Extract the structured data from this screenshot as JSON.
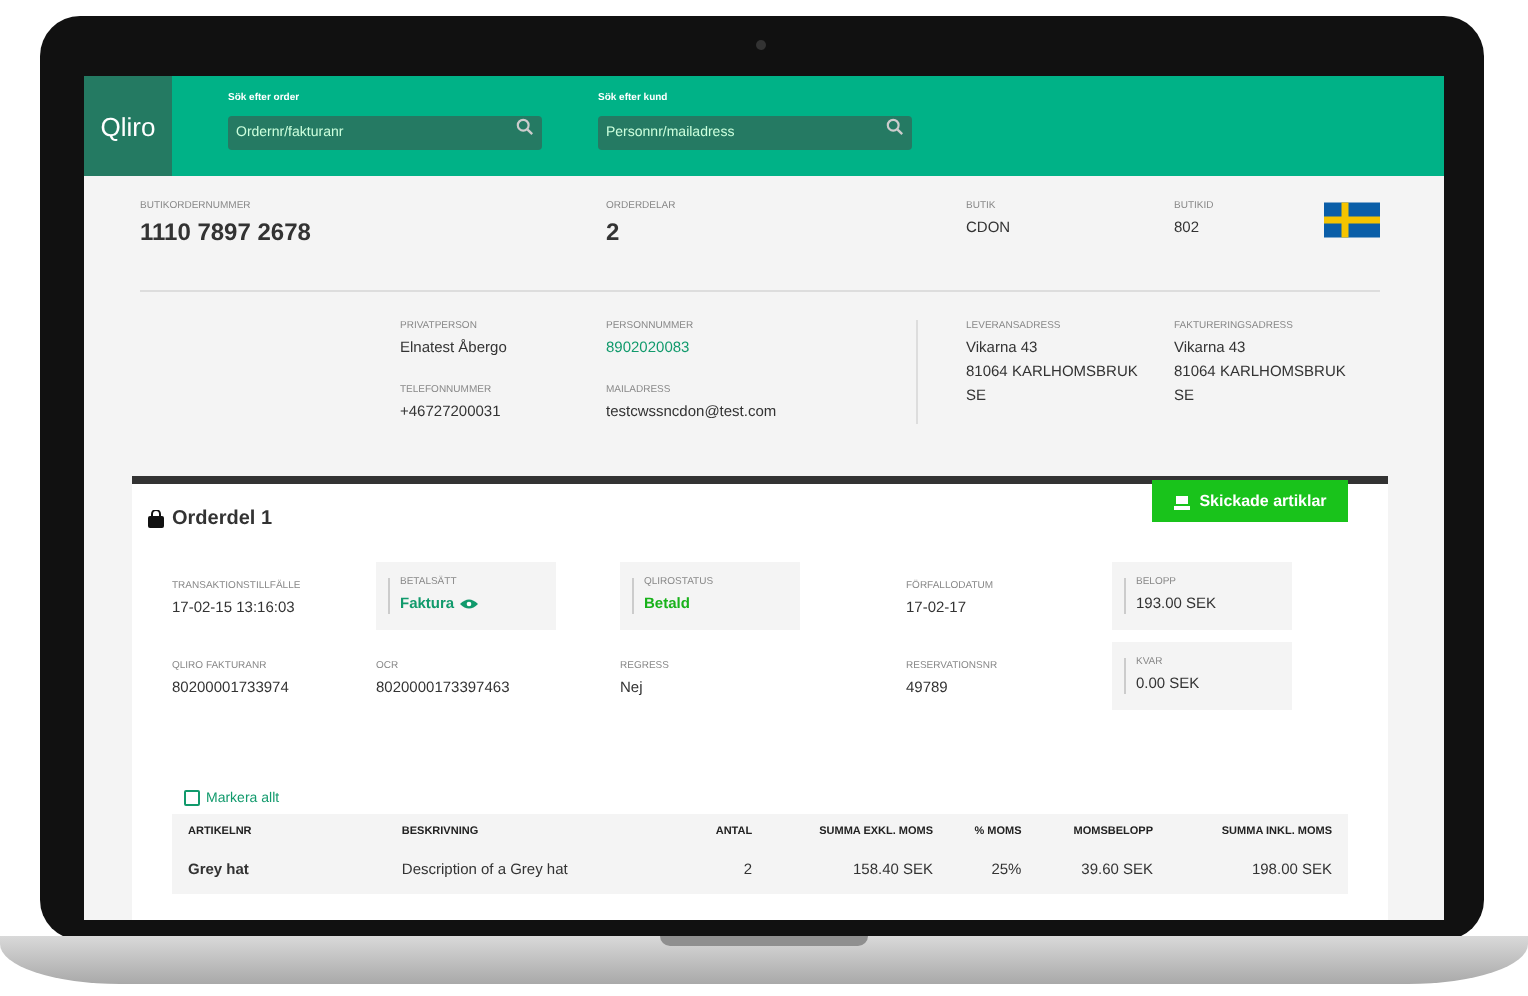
{
  "header": {
    "logo": "Qliro",
    "searches": [
      {
        "label": "Sök efter order",
        "placeholder": "Ordernr/fakturanr"
      },
      {
        "label": "Sök efter kund",
        "placeholder": "Personnr/mailadress"
      }
    ]
  },
  "summary": [
    {
      "label": "BUTIKORDERNUMMER",
      "value": "1110 7897 2678",
      "large": true
    },
    {
      "label": "ORDERDELAR",
      "value": "2",
      "large": true
    },
    {
      "label": "BUTIK",
      "value": "CDON",
      "large": false
    },
    {
      "label": "BUTIKID",
      "value": "802",
      "large": false
    }
  ],
  "customer": {
    "contact": [
      {
        "label": "PRIVATPERSON",
        "value": "Elnatest Åbergo",
        "link": false
      },
      {
        "label": "PERSONNUMMER",
        "value": "8902020083",
        "link": true
      },
      {
        "label": "TELEFONNUMMER",
        "value": "+46727200031",
        "link": false
      },
      {
        "label": "MAILADRESS",
        "value": "testcwssncdon@test.com",
        "link": false
      }
    ],
    "addresses": [
      {
        "label": "LEVERANSADRESS",
        "lines": [
          "Vikarna 43",
          "81064 KARLHOMSBRUK",
          "SE"
        ]
      },
      {
        "label": "FAKTURERINGSADRESS",
        "lines": [
          "Vikarna 43",
          "81064 KARLHOMSBRUK",
          "SE"
        ]
      }
    ]
  },
  "order_part": {
    "title": "Orderdel 1",
    "button": "Skickade artiklar",
    "fields": [
      {
        "label": "TRANSAKTIONSTILLFÄLLE",
        "value": "17-02-15 13:16:03",
        "boxed": false,
        "kind": "plain"
      },
      {
        "label": "BETALSÄTT",
        "value": "Faktura",
        "boxed": true,
        "kind": "link",
        "viewable": true
      },
      {
        "label": "QLIROSTATUS",
        "value": "Betald",
        "boxed": true,
        "kind": "success"
      },
      {
        "label": "FÖRFALLODATUM",
        "value": "17-02-17",
        "boxed": false,
        "kind": "plain"
      },
      {
        "label": "BELOPP",
        "value": "193.00 SEK",
        "boxed": true,
        "kind": "plain"
      },
      {
        "label": "QLIRO FAKTURANR",
        "value": "80200001733974",
        "boxed": false,
        "kind": "plain"
      },
      {
        "label": "OCR",
        "value": "8020000173397463",
        "boxed": false,
        "kind": "plain"
      },
      {
        "label": "REGRESS",
        "value": "Nej",
        "boxed": false,
        "kind": "plain"
      },
      {
        "label": "RESERVATIONSNR",
        "value": "49789",
        "boxed": false,
        "kind": "plain"
      },
      {
        "label": "KVAR",
        "value": "0.00 SEK",
        "boxed": true,
        "kind": "plain"
      }
    ],
    "select_all": {
      "label": "Markera allt",
      "checked": false
    },
    "table": {
      "columns": [
        {
          "label": "ARTIKELNR",
          "kind": "text"
        },
        {
          "label": "BESKRIVNING",
          "kind": "text"
        },
        {
          "label": "ANTAL",
          "kind": "number"
        },
        {
          "label": "SUMMA EXKL. MOMS",
          "kind": "number"
        },
        {
          "label": "% MOMS",
          "kind": "number"
        },
        {
          "label": "MOMSBELOPP",
          "kind": "number"
        },
        {
          "label": "SUMMA INKL. MOMS",
          "kind": "number"
        }
      ],
      "rows": [
        [
          "Grey hat",
          "Description of a Grey hat",
          "2",
          "158.40 SEK",
          "25%",
          "39.60 SEK",
          "198.00 SEK"
        ]
      ]
    }
  }
}
